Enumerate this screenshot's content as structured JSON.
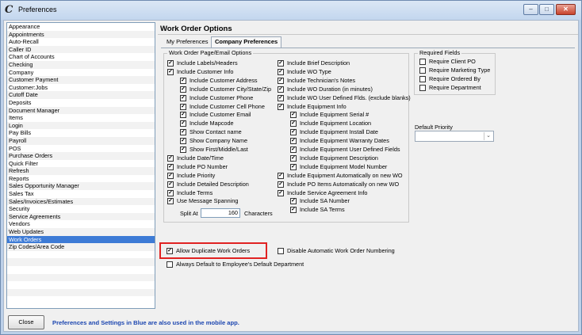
{
  "window": {
    "title": "Preferences",
    "app_icon": "C"
  },
  "sidebar": {
    "items": [
      "Appearance",
      "Appointments",
      "Auto-Recall",
      "Caller ID",
      "Chart of Accounts",
      "Checking",
      "Company",
      "Customer Payment",
      "Customer:Jobs",
      "Cutoff Date",
      "Deposits",
      "Document Manager",
      "Items",
      "Login",
      "Pay Bills",
      "Payroll",
      "POS",
      "Purchase Orders",
      "Quick Filter",
      "Refresh",
      "Reports",
      "Sales Opportunity Manager",
      "Sales Tax",
      "Sales/Invoices/Estimates",
      "Security",
      "Service Agreements",
      "Vendors",
      "Web Updates",
      "Work Orders",
      "Zip Codes/Area Code"
    ],
    "selected": "Work Orders"
  },
  "panel": {
    "title": "Work Order Options",
    "tabs": [
      {
        "label": "My Preferences",
        "active": false
      },
      {
        "label": "Company Preferences",
        "active": true
      }
    ],
    "page_email_group": {
      "legend": "Work Order Page/Email Options",
      "left_items": [
        {
          "label": "Include Labels/Headers",
          "checked": true,
          "indent": 0
        },
        {
          "label": "Include Customer Info",
          "checked": true,
          "indent": 0
        },
        {
          "label": "Include Customer Address",
          "checked": true,
          "indent": 1
        },
        {
          "label": "Include Customer City/State/Zip",
          "checked": true,
          "indent": 1
        },
        {
          "label": "Include Customer Phone",
          "checked": true,
          "indent": 1
        },
        {
          "label": "Include Customer Cell Phone",
          "checked": true,
          "indent": 1
        },
        {
          "label": "Include Customer Email",
          "checked": true,
          "indent": 1
        },
        {
          "label": "Include Mapcode",
          "checked": true,
          "indent": 1
        },
        {
          "label": "Show Contact name",
          "checked": true,
          "indent": 1
        },
        {
          "label": "Show Company Name",
          "checked": true,
          "indent": 1
        },
        {
          "label": "Show First/Middle/Last",
          "checked": true,
          "indent": 1
        },
        {
          "label": "Include Date/Time",
          "checked": true,
          "indent": 0
        },
        {
          "label": "Include PO Number",
          "checked": true,
          "indent": 0
        },
        {
          "label": "Include Priority",
          "checked": true,
          "indent": 0
        },
        {
          "label": "Include Detailed Description",
          "checked": true,
          "indent": 0
        },
        {
          "label": "Include Terms",
          "checked": true,
          "indent": 0
        },
        {
          "label": "Use Message Spanning",
          "checked": true,
          "indent": 0
        }
      ],
      "right_items": [
        {
          "label": "Include Brief Description",
          "checked": true,
          "indent": 0
        },
        {
          "label": "Include WO Type",
          "checked": true,
          "indent": 0
        },
        {
          "label": "Include Technician's Notes",
          "checked": true,
          "indent": 0
        },
        {
          "label": "Include WO Duration (in minutes)",
          "checked": true,
          "indent": 0
        },
        {
          "label": "Include WO User Defined Flds. (exclude blanks)",
          "checked": true,
          "indent": 0
        },
        {
          "label": "Include Equipment Info",
          "checked": true,
          "indent": 0
        },
        {
          "label": "Include Equipment Serial #",
          "checked": true,
          "indent": 1
        },
        {
          "label": "Include Equipment Location",
          "checked": true,
          "indent": 1
        },
        {
          "label": "Include Equipment Install Date",
          "checked": true,
          "indent": 1
        },
        {
          "label": "Include Equipment Warranty Dates",
          "checked": true,
          "indent": 1
        },
        {
          "label": "Include Equipment User Defined Fields",
          "checked": true,
          "indent": 1
        },
        {
          "label": "Include Equipment Description",
          "checked": true,
          "indent": 1
        },
        {
          "label": "Include Equipment Model Number",
          "checked": true,
          "indent": 1
        },
        {
          "label": "Include Equipment Automatically on new WO",
          "checked": true,
          "indent": 0
        },
        {
          "label": "Include PO Items Automatically on new WO",
          "checked": true,
          "indent": 0
        },
        {
          "label": "Include Service Agreement Info",
          "checked": true,
          "indent": 0
        },
        {
          "label": "Include SA Number",
          "checked": true,
          "indent": 1
        },
        {
          "label": "Include SA Terms",
          "checked": true,
          "indent": 1
        }
      ],
      "split_at": {
        "label": "Split At",
        "value": "160",
        "suffix": "Characters"
      }
    },
    "required_fields": {
      "legend": "Required Fields",
      "items": [
        {
          "label": "Require Client PO",
          "checked": false
        },
        {
          "label": "Require Marketing Type",
          "checked": false
        },
        {
          "label": "Require Ordered By",
          "checked": false
        },
        {
          "label": "Require Department",
          "checked": false
        }
      ]
    },
    "default_priority": {
      "label": "Default Priority",
      "value": ""
    },
    "bottom_options": [
      {
        "label": "Allow Duplicate Work Orders",
        "checked": true,
        "highlighted": true
      },
      {
        "label": "Disable Automatic Work Order Numbering",
        "checked": false
      },
      {
        "label": "Always Default to Employee's Default Department",
        "checked": false
      }
    ]
  },
  "footer": {
    "close_label": "Close",
    "note": "Preferences and Settings in Blue are also used in the mobile app."
  },
  "colors": {
    "selection": "#3d7bd6",
    "note_text": "#1c46b0",
    "highlight_box": "#e02222"
  }
}
